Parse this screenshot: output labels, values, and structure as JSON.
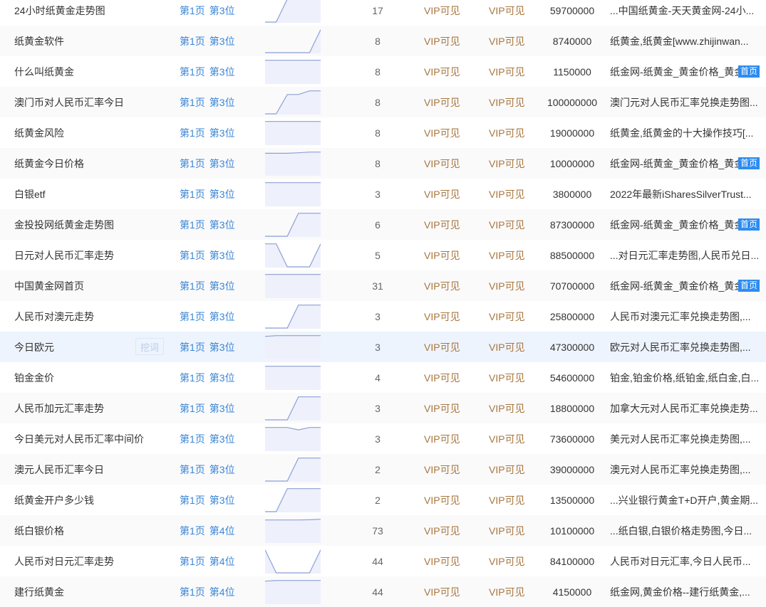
{
  "colors": {
    "link": "#3b86d6",
    "vip": "#a8763e",
    "badge": "#2d8cf0",
    "highlight_row": "#eef4fd",
    "spark_line": "#8e9fd8",
    "spark_fill": "#eef1fb"
  },
  "wa_button_label": "挖词",
  "rows": [
    {
      "keyword": "24小时纸黄金走势图",
      "page": "第1页",
      "pos": "第3位",
      "trend": [
        0,
        0,
        0.95,
        0.95,
        0.95,
        0.95
      ],
      "count": "17",
      "vip1": "VIP可见",
      "vip2": "VIP可见",
      "index": "59700000",
      "title": "...中国纸黄金-天天黄金网-24小...",
      "badge": ""
    },
    {
      "keyword": "纸黄金软件",
      "page": "第1页",
      "pos": "第3位",
      "trend": [
        0,
        0,
        0,
        0,
        0,
        0.95
      ],
      "count": "8",
      "vip1": "VIP可见",
      "vip2": "VIP可见",
      "index": "8740000",
      "title": "纸黄金,纸黄金[www.zhijinwan...",
      "badge": ""
    },
    {
      "keyword": "什么叫纸黄金",
      "page": "第1页",
      "pos": "第3位",
      "trend": [
        0.95,
        0.95,
        0.95,
        0.95,
        0.95,
        0.95
      ],
      "count": "8",
      "vip1": "VIP可见",
      "vip2": "VIP可见",
      "index": "1150000",
      "title": "纸金网-纸黄金_黄金价格_黄金",
      "badge": "首页"
    },
    {
      "keyword": "澳门币对人民币汇率今日",
      "page": "第1页",
      "pos": "第3位",
      "trend": [
        0,
        0,
        0.8,
        0.8,
        0.95,
        0.95
      ],
      "count": "8",
      "vip1": "VIP可见",
      "vip2": "VIP可见",
      "index": "100000000",
      "title": "澳门元对人民币汇率兑换走势图...",
      "badge": ""
    },
    {
      "keyword": "纸黄金风险",
      "page": "第1页",
      "pos": "第3位",
      "trend": [
        0.95,
        0.95,
        0.95,
        0.95,
        0.95,
        0.95
      ],
      "count": "8",
      "vip1": "VIP可见",
      "vip2": "VIP可见",
      "index": "19000000",
      "title": "纸黄金,纸黄金的十大操作技巧[...",
      "badge": ""
    },
    {
      "keyword": "纸黄金今日价格",
      "page": "第1页",
      "pos": "第3位",
      "trend": [
        0.9,
        0.9,
        0.9,
        0.92,
        0.95,
        0.95
      ],
      "count": "8",
      "vip1": "VIP可见",
      "vip2": "VIP可见",
      "index": "10000000",
      "title": "纸金网-纸黄金_黄金价格_黄金",
      "badge": "首页"
    },
    {
      "keyword": "白银etf",
      "page": "第1页",
      "pos": "第3位",
      "trend": [
        0.95,
        0.95,
        0.95,
        0.95,
        0.95,
        0.95
      ],
      "count": "3",
      "vip1": "VIP可见",
      "vip2": "VIP可见",
      "index": "3800000",
      "title": "2022年最新iSharesSilverTrust...",
      "badge": ""
    },
    {
      "keyword": "金投投网纸黄金走势图",
      "page": "第1页",
      "pos": "第3位",
      "trend": [
        0,
        0,
        0,
        0.95,
        0.95,
        0.95
      ],
      "count": "6",
      "vip1": "VIP可见",
      "vip2": "VIP可见",
      "index": "87300000",
      "title": "纸金网-纸黄金_黄金价格_黄金",
      "badge": "首页"
    },
    {
      "keyword": "日元对人民币汇率走势",
      "page": "第1页",
      "pos": "第3位",
      "trend": [
        0.95,
        0.95,
        0,
        0,
        0,
        0.95
      ],
      "count": "5",
      "vip1": "VIP可见",
      "vip2": "VIP可见",
      "index": "88500000",
      "title": "...对日元汇率走势图,人民币兑日...",
      "badge": ""
    },
    {
      "keyword": "中国黄金网首页",
      "page": "第1页",
      "pos": "第3位",
      "trend": [
        0.95,
        0.95,
        0.95,
        0.95,
        0.95,
        0.95
      ],
      "count": "31",
      "vip1": "VIP可见",
      "vip2": "VIP可见",
      "index": "70700000",
      "title": "纸金网-纸黄金_黄金价格_黄金",
      "badge": "首页"
    },
    {
      "keyword": "人民币对澳元走势",
      "page": "第1页",
      "pos": "第3位",
      "trend": [
        0,
        0,
        0,
        0.95,
        0.95,
        0.95
      ],
      "count": "3",
      "vip1": "VIP可见",
      "vip2": "VIP可见",
      "index": "25800000",
      "title": "人民币对澳元汇率兑换走势图,...",
      "badge": ""
    },
    {
      "keyword": "今日欧元",
      "page": "第1页",
      "pos": "第3位",
      "trend": [
        0.92,
        0.95,
        0.95,
        0.95,
        0.95,
        0.95
      ],
      "count": "3",
      "vip1": "VIP可见",
      "vip2": "VIP可见",
      "index": "47300000",
      "title": "欧元对人民币汇率兑换走势图,...",
      "badge": "",
      "highlight": true
    },
    {
      "keyword": "铂金金价",
      "page": "第1页",
      "pos": "第3位",
      "trend": [
        0.95,
        0.95,
        0.95,
        0.95,
        0.95,
        0.95
      ],
      "count": "4",
      "vip1": "VIP可见",
      "vip2": "VIP可见",
      "index": "54600000",
      "title": "铂金,铂金价格,纸铂金,纸白金,白...",
      "badge": ""
    },
    {
      "keyword": "人民币加元汇率走势",
      "page": "第1页",
      "pos": "第3位",
      "trend": [
        0,
        0,
        0,
        0.95,
        0.95,
        0.95
      ],
      "count": "3",
      "vip1": "VIP可见",
      "vip2": "VIP可见",
      "index": "18800000",
      "title": "加拿大元对人民币汇率兑换走势...",
      "badge": ""
    },
    {
      "keyword": "今日美元对人民币汇率中间价",
      "page": "第1页",
      "pos": "第3位",
      "trend": [
        0.95,
        0.95,
        0.95,
        0.85,
        0.95,
        0.95
      ],
      "count": "3",
      "vip1": "VIP可见",
      "vip2": "VIP可见",
      "index": "73600000",
      "title": "美元对人民币汇率兑换走势图,...",
      "badge": ""
    },
    {
      "keyword": "澳元人民币汇率今日",
      "page": "第1页",
      "pos": "第3位",
      "trend": [
        0,
        0,
        0,
        0.95,
        0.95,
        0.95
      ],
      "count": "2",
      "vip1": "VIP可见",
      "vip2": "VIP可见",
      "index": "39000000",
      "title": "澳元对人民币汇率兑换走势图,...",
      "badge": ""
    },
    {
      "keyword": "纸黄金开户多少钱",
      "page": "第1页",
      "pos": "第3位",
      "trend": [
        0,
        0,
        0.95,
        0.95,
        0.95,
        0.95
      ],
      "count": "2",
      "vip1": "VIP可见",
      "vip2": "VIP可见",
      "index": "13500000",
      "title": "...兴业银行黄金T+D开户,黄金期...",
      "badge": ""
    },
    {
      "keyword": "纸白银价格",
      "page": "第1页",
      "pos": "第4位",
      "trend": [
        0.92,
        0.92,
        0.92,
        0.92,
        0.93,
        0.95
      ],
      "count": "73",
      "vip1": "VIP可见",
      "vip2": "VIP可见",
      "index": "10100000",
      "title": "...纸白银,白银价格走势图,今日...",
      "badge": ""
    },
    {
      "keyword": "人民币对日元汇率走势",
      "page": "第1页",
      "pos": "第4位",
      "trend": [
        0.95,
        0,
        0,
        0,
        0,
        0.95
      ],
      "count": "44",
      "vip1": "VIP可见",
      "vip2": "VIP可见",
      "index": "84100000",
      "title": "人民币对日元汇率,今日人民币...",
      "badge": ""
    },
    {
      "keyword": "建行纸黄金",
      "page": "第1页",
      "pos": "第4位",
      "trend": [
        0.92,
        0.95,
        0.95,
        0.95,
        0.95,
        0.95
      ],
      "count": "44",
      "vip1": "VIP可见",
      "vip2": "VIP可见",
      "index": "4150000",
      "title": "纸金网,黄金价格--建行纸黄金,...",
      "badge": ""
    }
  ]
}
